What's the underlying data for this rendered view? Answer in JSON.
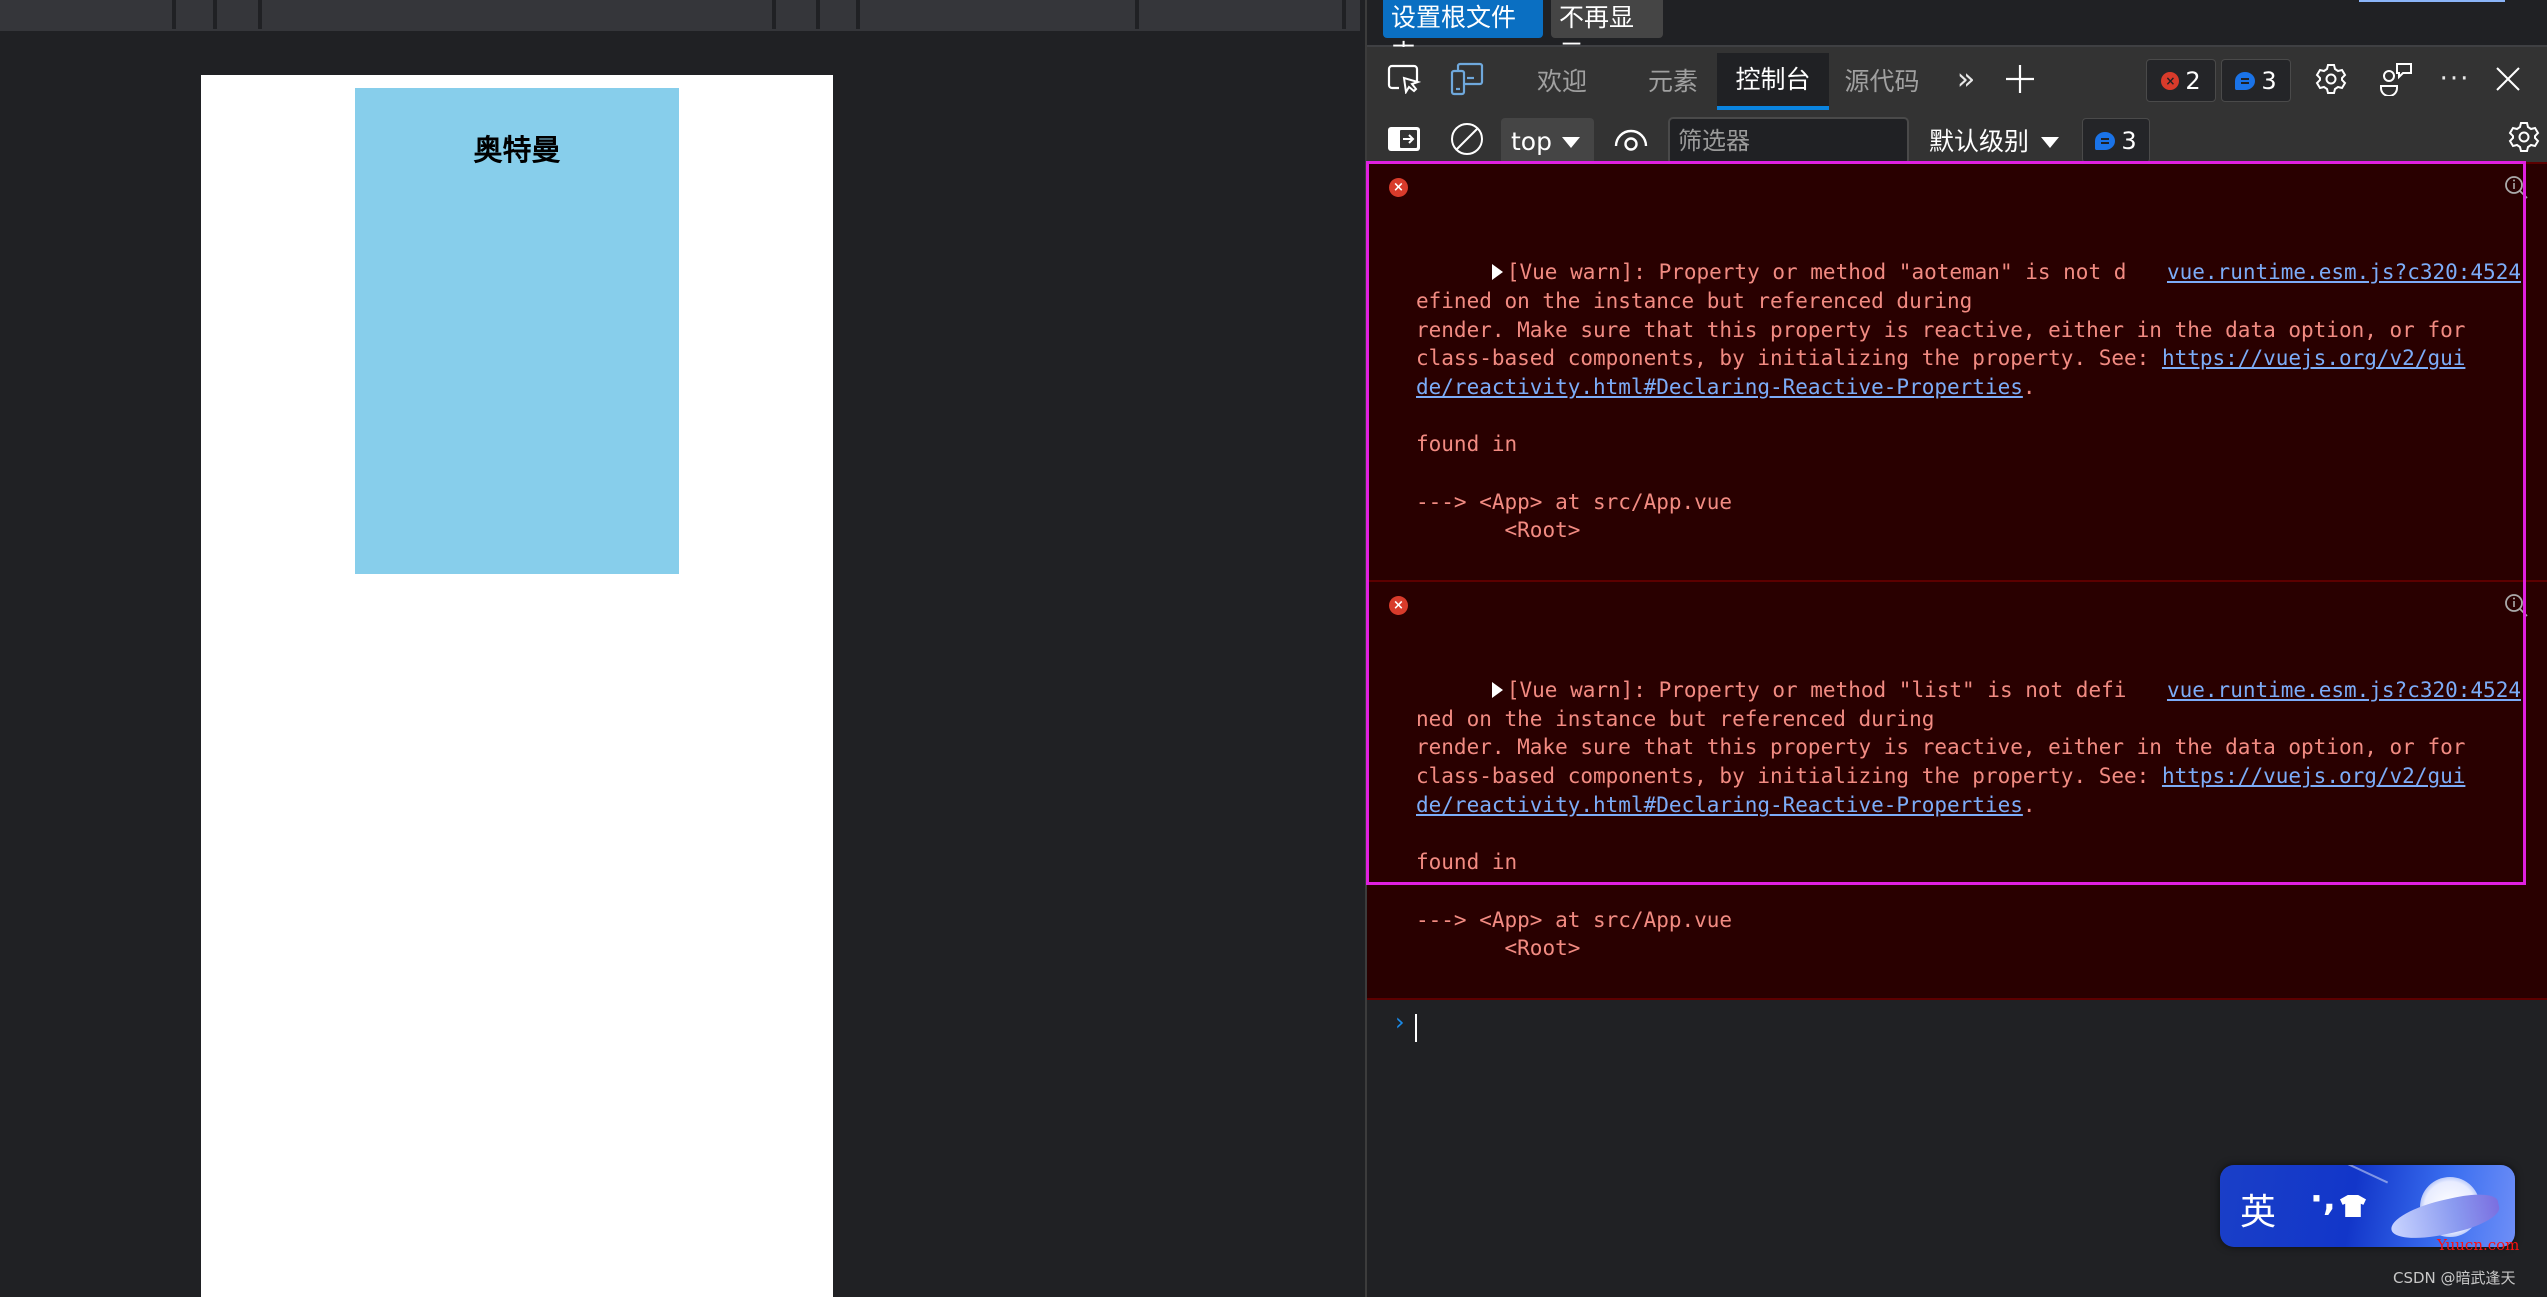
{
  "viewport": {
    "card_title": "奥特曼",
    "card_color": "#87ceeb"
  },
  "devtools": {
    "notification": {
      "set_root_button": "设置根文件夹",
      "dismiss_button": "不再显示"
    },
    "tabs": [
      {
        "label": "欢迎",
        "active": false
      },
      {
        "label": "元素",
        "active": false
      },
      {
        "label": "控制台",
        "active": true
      },
      {
        "label": "源代码",
        "active": false
      }
    ],
    "toolbar": {
      "more_tabs_icon": "chevrons-right-icon",
      "add_tab_icon": "plus-icon",
      "error_count": "2",
      "info_count": "3",
      "settings_icon": "gear-icon",
      "feedback_icon": "feedback-icon",
      "more_icon": "ellipsis-icon",
      "close_icon": "close-icon"
    },
    "console_toolbar": {
      "context": "top",
      "filter_placeholder": "筛选器",
      "filter_value": "",
      "level": "默认级别",
      "issues_count": "3"
    },
    "messages": [
      {
        "level": "error",
        "source": "vue.runtime.esm.js?c320:4524",
        "text_before_link": "[Vue warn]: Property or method \"aoteman\" is not defined on the instance but referenced during\nrender. Make sure that this property is reactive, either in the data option, or for class-based components, by initializing the property. See: ",
        "link": "https://vuejs.org/v2/guide/reactivity.html#Declaring-Reactive-Properties",
        "text_after_link": ".\n\nfound in\n\n---> <App> at src/App.vue\n       <Root>"
      },
      {
        "level": "error",
        "source": "vue.runtime.esm.js?c320:4524",
        "text_before_link": "[Vue warn]: Property or method \"list\" is not defined on the instance but referenced during\nrender. Make sure that this property is reactive, either in the data option, or for class-based components, by initializing the property. See: ",
        "link": "https://vuejs.org/v2/guide/reactivity.html#Declaring-Reactive-Properties",
        "text_after_link": ".\n\nfound in\n\n---> <App> at src/App.vue\n       <Root>"
      }
    ],
    "prompt_value": ""
  },
  "overlay": {
    "ime_mode": "英",
    "ime_punct": "·,",
    "watermark_site": "Yuucn.com",
    "watermark_author": "CSDN @暗武逢天"
  },
  "colors": {
    "accent": "#0a6fc2",
    "error_bg": "#290000",
    "error_text": "#f28b82",
    "link": "#7cacf8",
    "highlight": "#e020e0"
  }
}
